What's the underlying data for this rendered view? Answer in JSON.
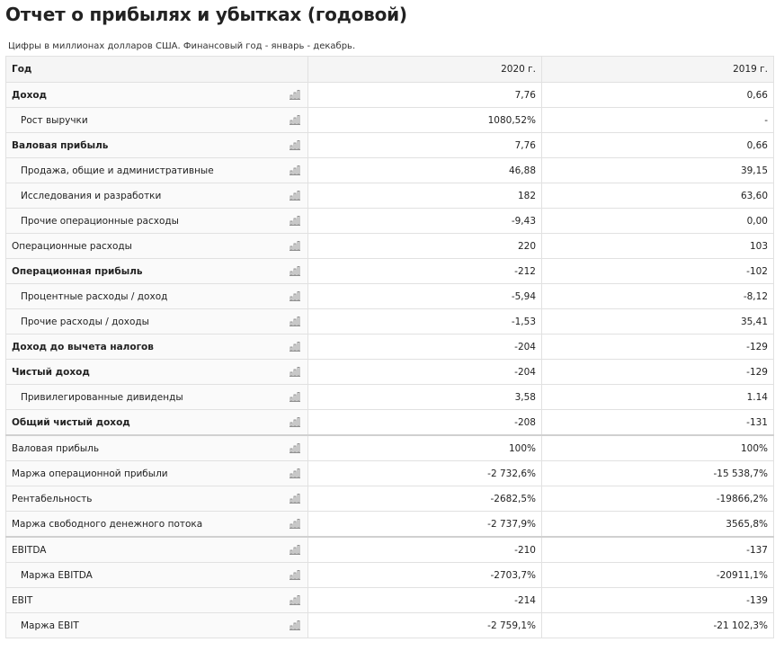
{
  "title": "Отчет о прибылях и убытках (годовой)",
  "subtitle": "Цифры в миллионах долларов США. Финансовый год - январь - декабрь.",
  "header": {
    "label": "Год",
    "col1": "2020 г.",
    "col2": "2019 г."
  },
  "icon_name": "bar-chart-icon",
  "rows": [
    {
      "label": "Доход",
      "v2020": "7,76",
      "v2019": "0,66",
      "bold": true,
      "indent": false,
      "sep": false
    },
    {
      "label": "Рост выручки",
      "v2020": "1080,52%",
      "v2019": "-",
      "bold": false,
      "indent": true,
      "sep": false
    },
    {
      "label": "Валовая прибыль",
      "v2020": "7,76",
      "v2019": "0,66",
      "bold": true,
      "indent": false,
      "sep": false
    },
    {
      "label": "Продажа, общие и административные",
      "v2020": "46,88",
      "v2019": "39,15",
      "bold": false,
      "indent": true,
      "sep": false
    },
    {
      "label": "Исследования и разработки",
      "v2020": "182",
      "v2019": "63,60",
      "bold": false,
      "indent": true,
      "sep": false
    },
    {
      "label": "Прочие операционные расходы",
      "v2020": "-9,43",
      "v2019": "0,00",
      "bold": false,
      "indent": true,
      "sep": false
    },
    {
      "label": "Операционные расходы",
      "v2020": "220",
      "v2019": "103",
      "bold": false,
      "indent": false,
      "sep": false
    },
    {
      "label": "Операционная прибыль",
      "v2020": "-212",
      "v2019": "-102",
      "bold": true,
      "indent": false,
      "sep": false
    },
    {
      "label": "Процентные расходы / доход",
      "v2020": "-5,94",
      "v2019": "-8,12",
      "bold": false,
      "indent": true,
      "sep": false
    },
    {
      "label": "Прочие расходы / доходы",
      "v2020": "-1,53",
      "v2019": "35,41",
      "bold": false,
      "indent": true,
      "sep": false
    },
    {
      "label": "Доход до вычета налогов",
      "v2020": "-204",
      "v2019": "-129",
      "bold": true,
      "indent": false,
      "sep": false
    },
    {
      "label": "Чистый доход",
      "v2020": "-204",
      "v2019": "-129",
      "bold": true,
      "indent": false,
      "sep": false
    },
    {
      "label": "Привилегированные дивиденды",
      "v2020": "3,58",
      "v2019": "1.14",
      "bold": false,
      "indent": true,
      "sep": false
    },
    {
      "label": "Общий чистый доход",
      "v2020": "-208",
      "v2019": "-131",
      "bold": true,
      "indent": false,
      "sep": false
    },
    {
      "label": "Валовая прибыль",
      "v2020": "100%",
      "v2019": "100%",
      "bold": false,
      "indent": false,
      "sep": true
    },
    {
      "label": "Маржа операционной прибыли",
      "v2020": "-2 732,6%",
      "v2019": "-15 538,7%",
      "bold": false,
      "indent": false,
      "sep": false
    },
    {
      "label": "Рентабельность",
      "v2020": "-2682,5%",
      "v2019": "-19866,2%",
      "bold": false,
      "indent": false,
      "sep": false
    },
    {
      "label": "Маржа свободного денежного потока",
      "v2020": "-2 737,9%",
      "v2019": "3565,8%",
      "bold": false,
      "indent": false,
      "sep": false
    },
    {
      "label": "EBITDA",
      "v2020": "-210",
      "v2019": "-137",
      "bold": false,
      "indent": false,
      "sep": true
    },
    {
      "label": "Маржа EBITDA",
      "v2020": "-2703,7%",
      "v2019": "-20911,1%",
      "bold": false,
      "indent": true,
      "sep": false
    },
    {
      "label": "EBIT",
      "v2020": "-214",
      "v2019": "-139",
      "bold": false,
      "indent": false,
      "sep": false
    },
    {
      "label": "Маржа EBIT",
      "v2020": "-2 759,1%",
      "v2019": "-21 102,3%",
      "bold": false,
      "indent": true,
      "sep": false
    }
  ]
}
